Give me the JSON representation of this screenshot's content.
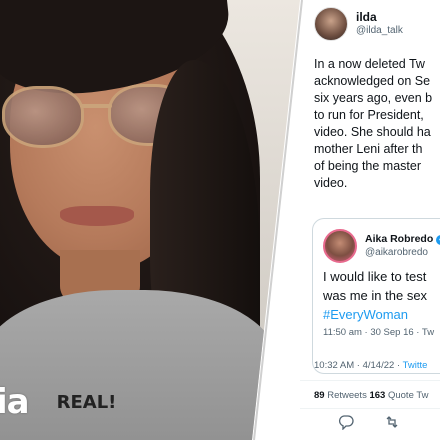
{
  "photo": {
    "caption_left": "ia",
    "caption_right": "REAL!"
  },
  "tweet": {
    "author": {
      "display_name": "ilda",
      "handle": "@ilda_talk"
    },
    "lines": [
      "In a now deleted Tw",
      "acknowledged on Se",
      "six years ago, even b",
      "to run for President,",
      "video. She should ha",
      "mother Leni after th",
      "of being the master",
      "video."
    ],
    "quoted": {
      "display_name": "Aika Robredo",
      "handle": "@aikarobredo",
      "lines": [
        "I would like to test",
        "was me in the sex"
      ],
      "hashtag": "#EveryWoman",
      "time": "11:50 am · 30 Sep 16 · Tw"
    },
    "timestamp": "10:32 AM · 4/14/22 · ",
    "source": "Twitte",
    "retweets_count": "89",
    "retweets_label": " Retweets ",
    "quotes_count": "163",
    "quotes_label": " Quote Tw"
  },
  "colors": {
    "link": "#1d9bf0",
    "text": "#0f1419",
    "muted": "#536471",
    "hair": "#1c1513"
  },
  "icons": [
    "reply-icon",
    "retweet-icon",
    "verified-icon"
  ]
}
